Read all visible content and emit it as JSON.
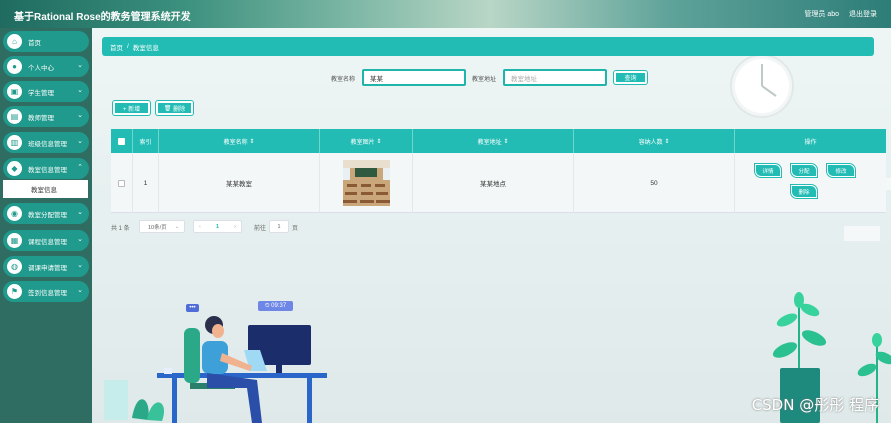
{
  "header": {
    "title": "基于Rational Rose的教务管理系统开发",
    "user_text": "管理员 abo",
    "logout": "退出登录"
  },
  "sidebar": {
    "items": [
      {
        "label": "首页",
        "icon": "home-icon",
        "glyph": "⌂",
        "arrow": false
      },
      {
        "label": "个人中心",
        "icon": "user-icon",
        "glyph": "●",
        "arrow": true
      },
      {
        "label": "学生管理",
        "icon": "student-icon",
        "glyph": "▣",
        "arrow": true
      },
      {
        "label": "教师管理",
        "icon": "teacher-icon",
        "glyph": "▤",
        "arrow": true
      },
      {
        "label": "班级信息管理",
        "icon": "class-icon",
        "glyph": "▥",
        "arrow": true
      },
      {
        "label": "教室信息管理",
        "icon": "classroom-icon",
        "glyph": "◆",
        "arrow": true
      },
      {
        "label": "教室分配管理",
        "icon": "allocation-icon",
        "glyph": "◉",
        "arrow": true
      },
      {
        "label": "课程信息管理",
        "icon": "course-icon",
        "glyph": "▦",
        "arrow": true
      },
      {
        "label": "调课申请管理",
        "icon": "reschedule-icon",
        "glyph": "◍",
        "arrow": true
      },
      {
        "label": "签到信息管理",
        "icon": "checkin-icon",
        "glyph": "⚑",
        "arrow": true
      }
    ],
    "sub_item": "教室信息"
  },
  "breadcrumb": {
    "home": "首页",
    "sep": "/",
    "current": "教室信息"
  },
  "search": {
    "name_label": "教室名称",
    "name_value": "某某",
    "address_label": "教室地址",
    "address_placeholder": "教室地址",
    "query_button": "查询"
  },
  "actions": {
    "add": "+ 新增",
    "delete": "删除"
  },
  "table": {
    "headers": [
      "索引",
      "教室名称",
      "教室图片",
      "教室地址",
      "容纳人数",
      "操作"
    ],
    "sort_mark": "⇕",
    "rows": [
      {
        "index": "1",
        "name": "某某教室",
        "address": "某某地点",
        "capacity": "50"
      }
    ],
    "row_actions": [
      "详情",
      "分配",
      "修改",
      "删除"
    ]
  },
  "pager": {
    "total": "共 1 条",
    "page_size": "10条/页",
    "prev": "‹",
    "current_page": "1",
    "next": "›",
    "goto_label": "前往",
    "goto_value": "1",
    "page_suffix": "页"
  },
  "illustration": {
    "clock_time": "09:37",
    "chat_glyph": "•••"
  },
  "watermark": "CSDN @彤彤 程序",
  "colors": {
    "accent": "#22bcb4",
    "sidebar": "#2f6d63",
    "sidebar_item": "#1f9a8c"
  }
}
